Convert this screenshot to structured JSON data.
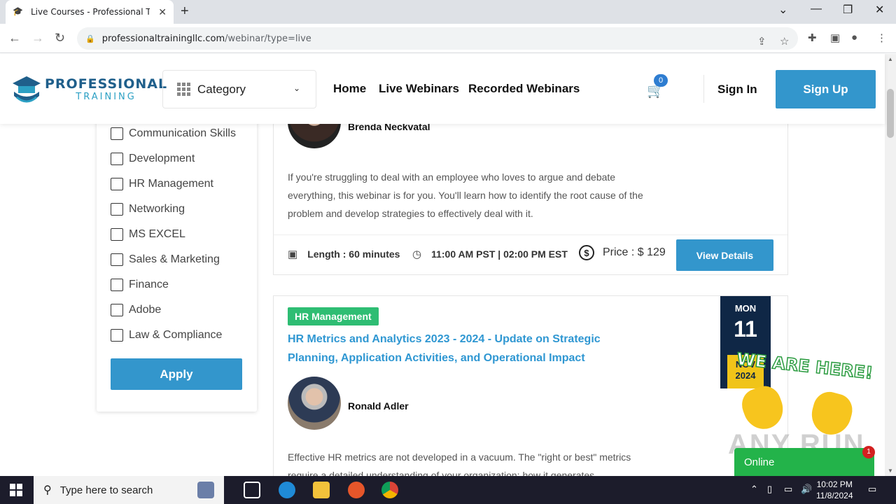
{
  "browser": {
    "tab_title": "Live Courses - Professional Trainin",
    "url_host": "professionaltrainingllc.com",
    "url_path": "/webinar/type=live"
  },
  "header": {
    "logo_line1": "PROFESSIONAL",
    "logo_line2": "TRAINING",
    "category_label": "Category",
    "menu": [
      "Home",
      "Live Webinars",
      "Recorded Webinars"
    ],
    "cart_count": "0",
    "signin": "Sign In",
    "signup": "Sign Up"
  },
  "filters": {
    "items": [
      "Communication Skills",
      "Development",
      "HR Management",
      "Networking",
      "MS EXCEL",
      "Sales & Marketing",
      "Finance",
      "Adobe",
      "Law & Compliance"
    ],
    "apply": "Apply"
  },
  "course1": {
    "instructor": "Brenda Neckvatal",
    "description": "If you're struggling to deal with an employee who loves to argue and debate everything, this webinar is for you. You'll learn how to identify the root cause of the problem and develop strategies to effectively deal with it.",
    "length": "Length : 60 minutes",
    "time": "11:00 AM PST | 02:00 PM EST",
    "price": "Price : $ 129",
    "view_details": "View Details"
  },
  "course2": {
    "tag": "HR Management",
    "title": "HR Metrics and Analytics 2023 - 2024 - Update on Strategic Planning, Application Activities, and Operational Impact",
    "instructor": "Ronald Adler",
    "description": "Effective HR metrics are not developed in a vacuum. The \"right or best\" metrics require a detailed understanding of your organization; how it generates",
    "date_dow": "MON",
    "date_day": "11",
    "date_month": "NOV",
    "date_year": "2024"
  },
  "chat": {
    "banner": "WE ARE HERE!",
    "status": "Online",
    "badge": "1",
    "watermark": "ANY RUN"
  },
  "taskbar": {
    "search_placeholder": "Type here to search",
    "time": "10:02 PM",
    "date": "11/8/2024"
  },
  "colors": {
    "brand_blue": "#3396cc",
    "tag_green": "#2ebd73",
    "date_navy": "#0f2746",
    "date_yellow": "#f0c419"
  }
}
